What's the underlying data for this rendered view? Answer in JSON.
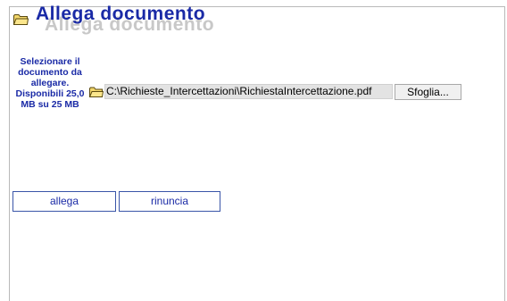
{
  "header": {
    "title": "Allega documento",
    "icon": "folder-icon"
  },
  "upload": {
    "instructions": "Selezionare il documento da allegare. Disponibili 25,0 MB su 25 MB",
    "file_path": "C:\\Richieste_Intercettazioni\\RichiestaIntercettazione.pdf",
    "browse_label": "Sfoglia...",
    "file_icon": "folder-icon"
  },
  "actions": {
    "attach_label": "allega",
    "cancel_label": "rinuncia"
  },
  "colors": {
    "accent": "#1a2aa6",
    "title_shadow": "#c8c8c8",
    "folder_fill": "#f2d66b",
    "button_border": "#3a55a8"
  }
}
